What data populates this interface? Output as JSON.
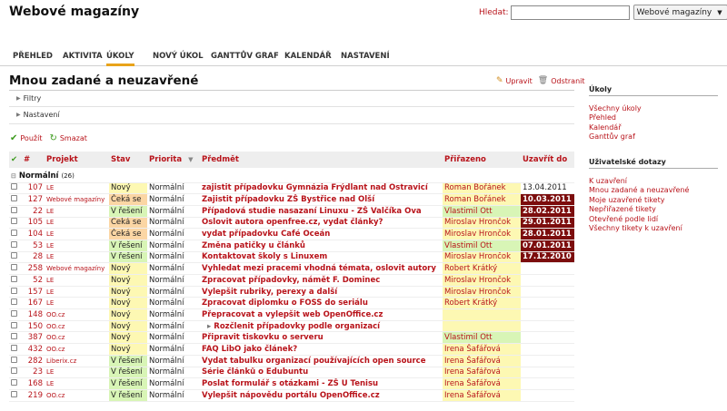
{
  "app": {
    "title": "Webové magazíny"
  },
  "search": {
    "label": "Hledat:",
    "value": "",
    "select_value": "Webové magazíny"
  },
  "tabs": [
    "PŘEHLED",
    "AKTIVITA",
    "ÚKOLY",
    "NOVÝ ÚKOL",
    "GANTTŮV GRAF",
    "KALENDÁŘ",
    "NASTAVENÍ"
  ],
  "page": {
    "title": "Mnou zadané a neuzavřené",
    "edit_label": "Upravit",
    "delete_label": "Odstranit",
    "filters_label": "Filtry",
    "settings_label": "Nastavení",
    "apply_label": "Použít",
    "clear_label": "Smazat"
  },
  "table": {
    "headers": {
      "check": "✔",
      "num": "#",
      "project": "Projekt",
      "status": "Stav",
      "priority": "Priorita",
      "subject": "Předmět",
      "assigned": "Přiřazeno",
      "due": "Uzavřít do"
    },
    "group_label": "Normální",
    "group_count": "(26)",
    "rows": [
      {
        "num": "107",
        "proj": "LE",
        "stav": "Nový",
        "pri": "Normální",
        "subj": "zajistit případovku Gymnázia Frýdlant nad Ostravicí",
        "ass": "Roman Bořánek",
        "due": "13.04.2011",
        "st": "new",
        "ag": false,
        "od": false,
        "child": false
      },
      {
        "num": "127",
        "proj": "Webové magazíny",
        "stav": "Čeká se",
        "pri": "Normální",
        "subj": "Zajistit případovku ZŠ Bystřice nad Olší",
        "ass": "Roman Bořánek",
        "due": "10.03.2011",
        "st": "wait",
        "ag": false,
        "od": true,
        "child": false
      },
      {
        "num": "22",
        "proj": "LE",
        "stav": "V řešení",
        "pri": "Normální",
        "subj": "Případová studie nasazaní Linuxu - ZŠ Valčíka Ova",
        "ass": "Vlastimil Ott",
        "due": "28.02.2011",
        "st": "solve",
        "ag": true,
        "od": true,
        "child": false
      },
      {
        "num": "105",
        "proj": "LE",
        "stav": "Čeká se",
        "pri": "Normální",
        "subj": "Oslovit autora openfree.cz, vydat články?",
        "ass": "Miroslav Hrončok",
        "due": "29.01.2011",
        "st": "wait",
        "ag": false,
        "od": true,
        "child": false
      },
      {
        "num": "104",
        "proj": "LE",
        "stav": "Čeká se",
        "pri": "Normální",
        "subj": "vydat případovku Café Oceán",
        "ass": "Miroslav Hrončok",
        "due": "28.01.2011",
        "st": "wait",
        "ag": false,
        "od": true,
        "child": false
      },
      {
        "num": "53",
        "proj": "LE",
        "stav": "V řešení",
        "pri": "Normální",
        "subj": "Změna patičky u článků",
        "ass": "Vlastimil Ott",
        "due": "07.01.2011",
        "st": "solve",
        "ag": true,
        "od": true,
        "child": false
      },
      {
        "num": "28",
        "proj": "LE",
        "stav": "V řešení",
        "pri": "Normální",
        "subj": "Kontaktovat školy s Linuxem",
        "ass": "Miroslav Hrončok",
        "due": "17.12.2010",
        "st": "solve",
        "ag": false,
        "od": true,
        "child": false
      },
      {
        "num": "258",
        "proj": "Webové magazíny",
        "stav": "Nový",
        "pri": "Normální",
        "subj": "Vyhledat mezi pracemi vhodná témata, oslovit autory",
        "ass": "Robert Krátký",
        "due": "",
        "st": "new",
        "ag": false,
        "od": false,
        "child": false
      },
      {
        "num": "52",
        "proj": "LE",
        "stav": "Nový",
        "pri": "Normální",
        "subj": "Zpracovat případovky, námět F. Dominec",
        "ass": "Miroslav Hrončok",
        "due": "",
        "st": "new",
        "ag": false,
        "od": false,
        "child": false
      },
      {
        "num": "157",
        "proj": "LE",
        "stav": "Nový",
        "pri": "Normální",
        "subj": "Vylepšit rubriky, perexy a další",
        "ass": "Miroslav Hrončok",
        "due": "",
        "st": "new",
        "ag": false,
        "od": false,
        "child": false
      },
      {
        "num": "167",
        "proj": "LE",
        "stav": "Nový",
        "pri": "Normální",
        "subj": "Zpracovat diplomku o FOSS do seriálu",
        "ass": "Robert Krátký",
        "due": "",
        "st": "new",
        "ag": false,
        "od": false,
        "child": false
      },
      {
        "num": "148",
        "proj": "OO.cz",
        "stav": "Nový",
        "pri": "Normální",
        "subj": "Přepracovat a vylepšit web OpenOffice.cz",
        "ass": "",
        "due": "",
        "st": "new",
        "ag": false,
        "od": false,
        "child": false
      },
      {
        "num": "150",
        "proj": "OO.cz",
        "stav": "Nový",
        "pri": "Normální",
        "subj": "Rozčlenit případovky podle organizací",
        "ass": "",
        "due": "",
        "st": "new",
        "ag": false,
        "od": false,
        "child": true
      },
      {
        "num": "387",
        "proj": "OO.cz",
        "stav": "Nový",
        "pri": "Normální",
        "subj": "Připravit tiskovku o serveru",
        "ass": "Vlastimil Ott",
        "due": "",
        "st": "new",
        "ag": true,
        "od": false,
        "child": false
      },
      {
        "num": "432",
        "proj": "OO.cz",
        "stav": "Nový",
        "pri": "Normální",
        "subj": "FAQ LibO jako článek?",
        "ass": "Irena Šafářová",
        "due": "",
        "st": "new",
        "ag": false,
        "od": false,
        "child": false
      },
      {
        "num": "282",
        "proj": "Liberix.cz",
        "stav": "V řešení",
        "pri": "Normální",
        "subj": "Vydat tabulku organizací používajících open source",
        "ass": "Irena Šafářová",
        "due": "",
        "st": "solve",
        "ag": false,
        "od": false,
        "child": false
      },
      {
        "num": "23",
        "proj": "LE",
        "stav": "V řešení",
        "pri": "Normální",
        "subj": "Série článků o Edubuntu",
        "ass": "Irena Šafářová",
        "due": "",
        "st": "solve",
        "ag": false,
        "od": false,
        "child": false
      },
      {
        "num": "168",
        "proj": "LE",
        "stav": "V řešení",
        "pri": "Normální",
        "subj": "Poslat formulář s otázkami - ZŠ U Tenisu",
        "ass": "Irena Šafářová",
        "due": "",
        "st": "solve",
        "ag": false,
        "od": false,
        "child": false
      },
      {
        "num": "219",
        "proj": "OO.cz",
        "stav": "V řešení",
        "pri": "Normální",
        "subj": "Vylepšit nápovědu portálu OpenOffice.cz",
        "ass": "Irena Šafářová",
        "due": "",
        "st": "solve",
        "ag": false,
        "od": false,
        "child": false
      }
    ]
  },
  "sidebar": {
    "tasks_heading": "Úkoly",
    "tasks_links": [
      "Všechny úkoly",
      "Přehled",
      "Kalendář",
      "Ganttův graf"
    ],
    "queries_heading": "Uživatelské dotazy",
    "queries_links": [
      "K uzavření",
      "Mnou zadané a neuzavřené",
      "Moje uzavřené tikety",
      "Nepřiřazené tikety",
      "Otevřené podle lidí",
      "Všechny tikety k uzavření"
    ]
  },
  "colors": {
    "link": "#b8131a",
    "tab_active": "#e8a31a",
    "overdue": "#7c0d0d",
    "status_new": "#fdf8b3",
    "status_wait": "#fbd6a4",
    "status_solve": "#d8f5b6"
  }
}
